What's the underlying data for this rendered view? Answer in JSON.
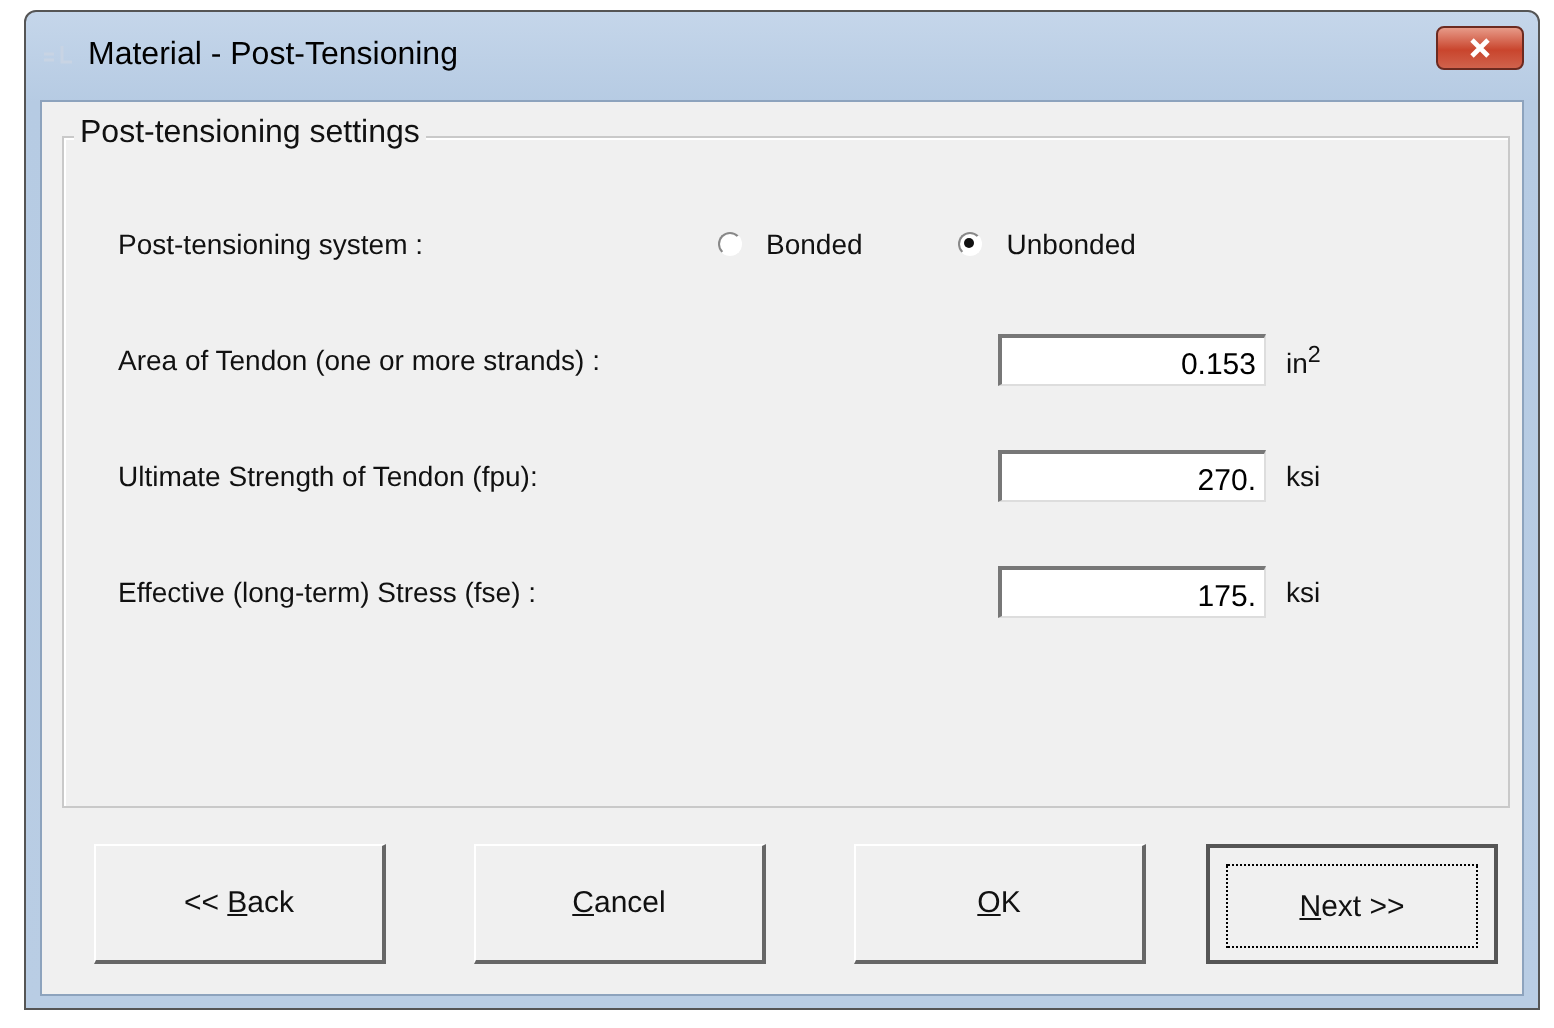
{
  "window": {
    "title": "Material - Post-Tensioning"
  },
  "group": {
    "title": "Post-tensioning settings",
    "system": {
      "label": "Post-tensioning system :",
      "options": [
        {
          "label": "Bonded",
          "selected": false
        },
        {
          "label": "Unbonded",
          "selected": true
        }
      ]
    },
    "fields": [
      {
        "label": "Area of Tendon (one or more strands) :",
        "value": "0.153",
        "unit": "in$^{2}$"
      },
      {
        "label": "Ultimate Strength of Tendon (fpu):",
        "value": "270.",
        "unit": "ksi"
      },
      {
        "label": "Effective (long-term) Stress (fse) :",
        "value": "175.",
        "unit": "ksi"
      }
    ]
  },
  "buttons": [
    {
      "before": "<< ",
      "mnemonic": "B",
      "after": "ack",
      "default": false
    },
    {
      "mnemonic": "C",
      "after": "ancel",
      "default": false
    },
    {
      "mnemonic": "O",
      "after": "K",
      "default": false
    },
    {
      "mnemonic": "N",
      "after": "ext >>",
      "default": true
    }
  ]
}
